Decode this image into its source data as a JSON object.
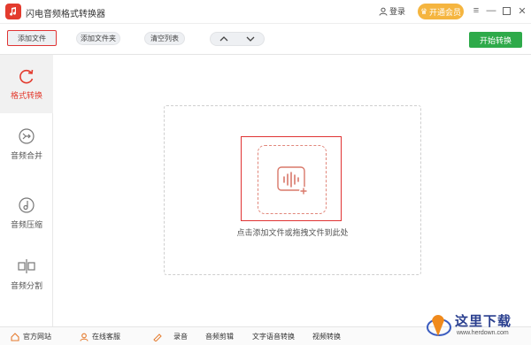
{
  "app": {
    "title": "闪电音频格式转换器",
    "login_label": "登录",
    "vip_label": "开通会员"
  },
  "toolbar": {
    "add_file": "添加文件",
    "add_folder": "添加文件夹",
    "clear_list": "清空列表",
    "start": "开始转换"
  },
  "sidebar": {
    "items": [
      {
        "label": "格式转换",
        "icon": "refresh-icon",
        "active": true
      },
      {
        "label": "音频合并",
        "icon": "merge-icon",
        "active": false
      },
      {
        "label": "音频压缩",
        "icon": "compress-icon",
        "active": false
      },
      {
        "label": "音频分割",
        "icon": "split-icon",
        "active": false
      }
    ]
  },
  "main": {
    "drop_hint": "点击添加文件或拖拽文件到此处"
  },
  "bottom": {
    "items": [
      {
        "label": "官方网站",
        "icon": "home-icon"
      },
      {
        "label": "在线客服",
        "icon": "support-icon"
      },
      {
        "label": "录音",
        "icon": "mic-icon"
      },
      {
        "label": "音频剪辑",
        "icon": "audio-edit-icon"
      },
      {
        "label": "文字语音转换",
        "icon": "text-speech-icon"
      },
      {
        "label": "视频转换",
        "icon": "video-convert-icon"
      }
    ]
  },
  "watermark": {
    "text": "这里下载",
    "url": "www.herdown.com"
  },
  "colors": {
    "brand_red": "#e33b2e",
    "start_green": "#2eaa4a",
    "vip_orange": "#f5b53f",
    "highlight_red": "#e03434"
  }
}
